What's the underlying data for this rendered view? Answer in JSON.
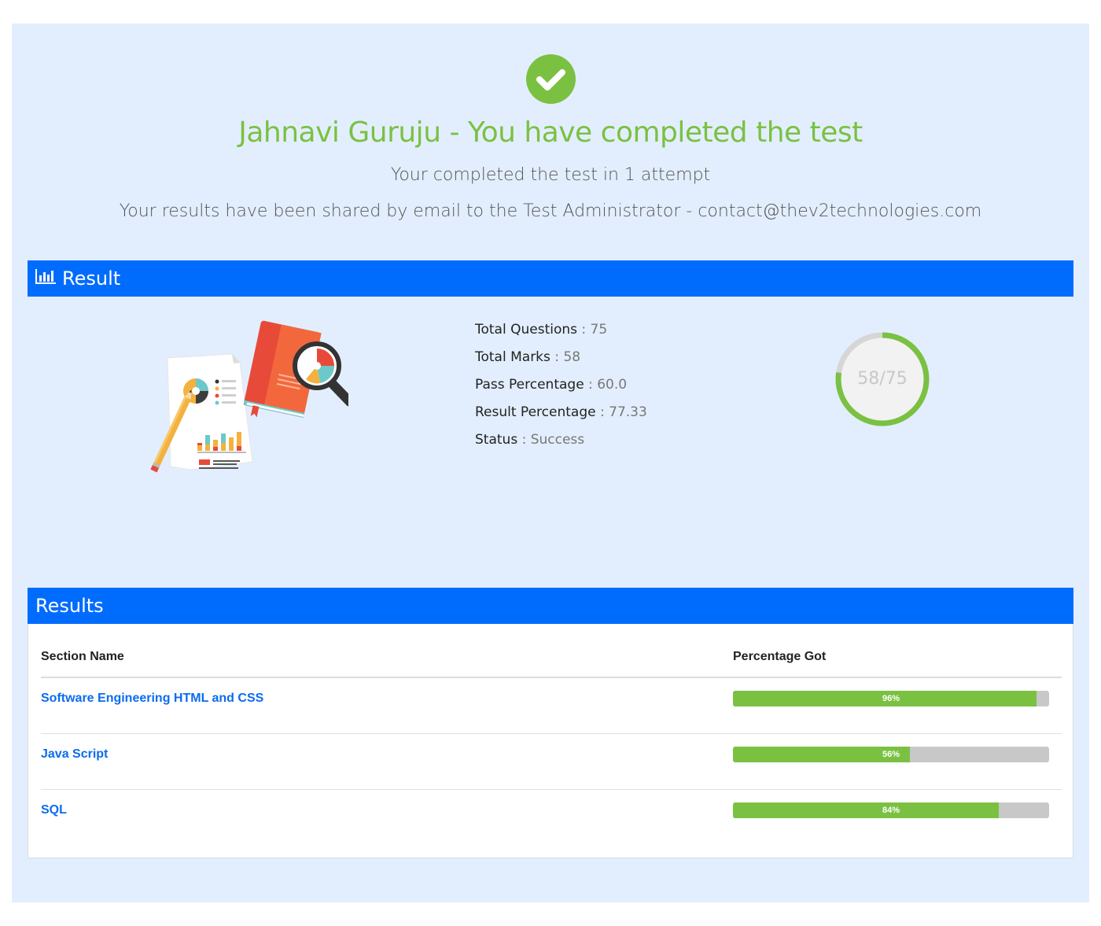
{
  "header": {
    "icon": "check-circle-icon",
    "title": "Jahnavi Guruju - You have completed the test",
    "attempt_text": "Your completed the test in 1 attempt",
    "shared_text": "Your results have been shared by email to the Test Administrator - contact@thev2technologies.com"
  },
  "result_panel": {
    "heading": "Result",
    "heading_icon": "bar-chart-icon",
    "illustration": "report-analysis-illustration",
    "stats": [
      {
        "label": "Total Questions",
        "value": "75"
      },
      {
        "label": "Total Marks",
        "value": "58"
      },
      {
        "label": "Pass Percentage",
        "value": "60.0"
      },
      {
        "label": "Result Percentage",
        "value": "77.33"
      },
      {
        "label": "Status",
        "value": "Success"
      }
    ],
    "score": {
      "label": "58/75",
      "obtained": 58,
      "total": 75
    }
  },
  "results_panel": {
    "heading": "Results",
    "columns": [
      "Section Name",
      "Percentage Got"
    ],
    "rows": [
      {
        "section": "Software Engineering HTML and CSS",
        "percent": 96,
        "percent_label": "96%"
      },
      {
        "section": "Java Script",
        "percent": 56,
        "percent_label": "56%"
      },
      {
        "section": "SQL",
        "percent": 84,
        "percent_label": "84%"
      }
    ]
  },
  "colors": {
    "accent_green": "#7ac142",
    "header_blue": "#006cfe",
    "page_bg": "#e2eefd",
    "link_blue": "#0a6cf0",
    "bar_track": "#c8c8c8"
  }
}
